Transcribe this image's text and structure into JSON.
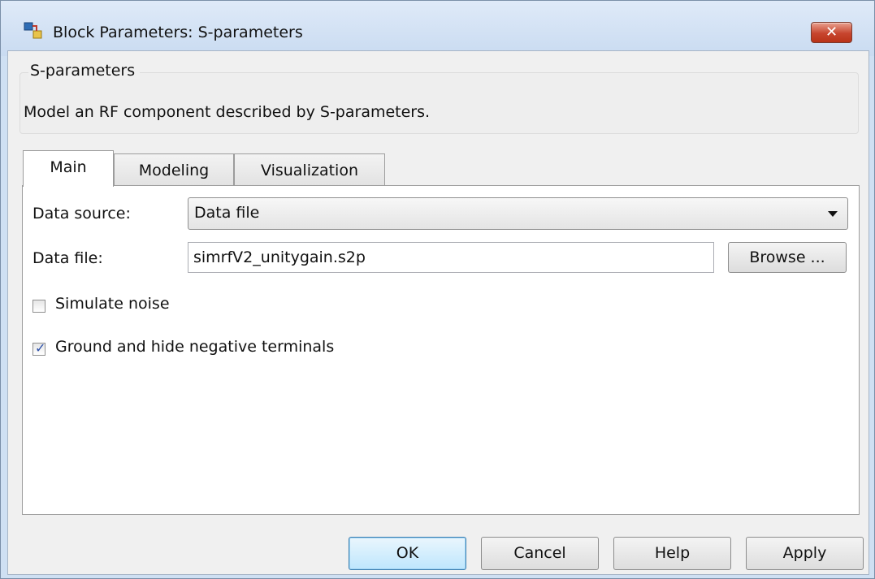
{
  "window": {
    "title": "Block Parameters: S-parameters",
    "close_glyph": "✕"
  },
  "description": {
    "group_title": "S-parameters",
    "text": "Model an RF component described by S-parameters."
  },
  "tabs": [
    {
      "label": "Main",
      "active": true
    },
    {
      "label": "Modeling",
      "active": false
    },
    {
      "label": "Visualization",
      "active": false
    }
  ],
  "main": {
    "data_source_label": "Data source:",
    "data_source_value": "Data file",
    "data_file_label": "Data file:",
    "data_file_value": "simrfV2_unitygain.s2p",
    "browse_label": "Browse ...",
    "simulate_noise_label": "Simulate noise",
    "simulate_noise_checked": false,
    "ground_label": "Ground and hide negative terminals",
    "ground_checked": true,
    "check_glyph": "✓"
  },
  "buttons": {
    "ok": "OK",
    "cancel": "Cancel",
    "help": "Help",
    "apply": "Apply"
  },
  "icons": {
    "window_icon": "simulink-block-icon",
    "close_icon": "close-icon",
    "dropdown_icon": "chevron-down-icon",
    "check_icon": "check-icon"
  },
  "colors": {
    "title_bar": "#cfe0f3",
    "close_button": "#c7452e",
    "panel_background": "#f0f0f0",
    "tab_panel_background": "#ffffff",
    "checkmark": "#2b4fa8"
  }
}
